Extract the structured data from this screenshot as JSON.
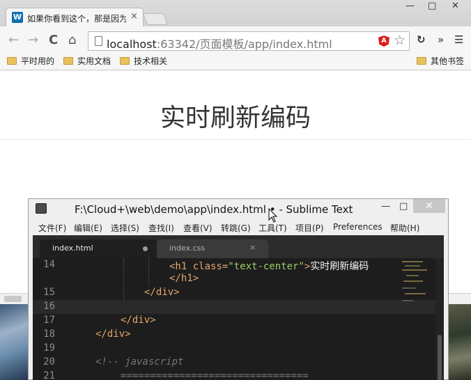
{
  "browser": {
    "tab": {
      "favicon_letter": "W",
      "title": "如果你看到这个，那是因为",
      "close": "×"
    },
    "window_controls": {
      "minimize": "—",
      "maximize": "□",
      "close": "✕"
    },
    "nav": {
      "back": "←",
      "forward": "→",
      "reload": "C",
      "home": "⌂"
    },
    "address": {
      "host": "localhost",
      "rest": ":63342/页面模板/app/index.html"
    },
    "toolbar_icons": {
      "angular_letter": "A",
      "star": "☆",
      "extension": "↻",
      "more_ext": "»",
      "menu": "☰"
    },
    "bookmarks": [
      "平时用的",
      "实用文档",
      "技术相关"
    ],
    "other_bookmarks": "其他书签"
  },
  "page": {
    "heading": "实时刷新编码"
  },
  "sublime": {
    "title": "F:\\Cloud+\\web\\demo\\app\\index.html • - Sublime Text",
    "window_controls": {
      "minimize": "—",
      "maximize": "□",
      "close": "✕"
    },
    "menu": [
      "文件(F)",
      "编辑(E)",
      "选择(S)",
      "查找(I)",
      "查看(V)",
      "转跳(G)",
      "工具(T)",
      "项目(P)",
      "Preferences",
      "帮助(H)"
    ],
    "tabs": [
      {
        "label": "index.html",
        "state": "modified"
      },
      {
        "label": "index.css",
        "close": "×"
      }
    ],
    "lines": [
      {
        "n": "14",
        "indent": "",
        "code": {
          "open": "<h1 ",
          "attr": "class=",
          "str": "\"text-center\"",
          "close": ">",
          "text": "实时刷新编码"
        }
      },
      {
        "n": "",
        "code_plain": "</h1>"
      },
      {
        "n": "15",
        "code_plain": "</div>"
      },
      {
        "n": "16",
        "code_plain": ""
      },
      {
        "n": "17",
        "code_plain": "</div>"
      },
      {
        "n": "18",
        "code_plain": "</div>"
      },
      {
        "n": "19",
        "code_plain": ""
      },
      {
        "n": "20",
        "comment": "<!-- javascript"
      },
      {
        "n": "21",
        "comment": "================================"
      }
    ]
  }
}
